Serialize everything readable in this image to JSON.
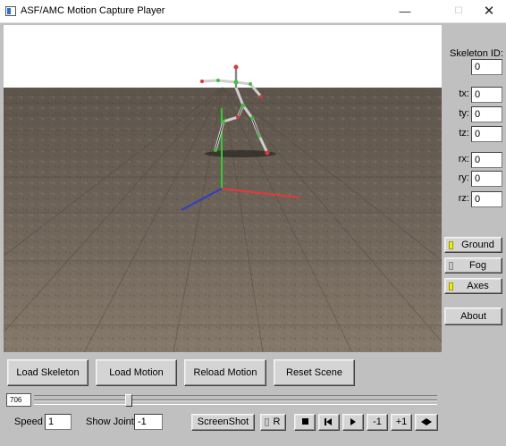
{
  "window": {
    "title": "ASF/AMC Motion Capture Player",
    "min_glyph": "—",
    "max_glyph": "☐",
    "close_glyph": "✕"
  },
  "colors": {
    "sky": "#ffffff",
    "ground": "#6e6256",
    "x_axis": "#e23a3a",
    "y_axis": "#2ecf2e",
    "z_axis": "#2c3ec9",
    "bone": "#c8c8c8",
    "joint_green": "#3fbf3f",
    "joint_red": "#d63a3a",
    "led_on": "#f2f200",
    "panel": "#c0c0c0"
  },
  "right_panel": {
    "skeleton_id_label": "Skeleton ID:",
    "skeleton_id_value": "0",
    "tx_label": "tx:",
    "tx_value": "0",
    "ty_label": "ty:",
    "ty_value": "0",
    "tz_label": "tz:",
    "tz_value": "0",
    "rx_label": "rx:",
    "rx_value": "0",
    "ry_label": "ry:",
    "ry_value": "0",
    "rz_label": "rz:",
    "rz_value": "0",
    "ground_label": "Ground",
    "ground_on": true,
    "fog_label": "Fog",
    "fog_on": false,
    "axes_label": "Axes",
    "axes_on": true,
    "about_label": "About"
  },
  "buttons": {
    "load_skeleton": "Load Skeleton",
    "load_motion": "Load Motion",
    "reload_motion": "Reload Motion",
    "reset_scene": "Reset Scene"
  },
  "timeline": {
    "frame_value": "706",
    "position_fraction": 0.23
  },
  "controls": {
    "speed_label": "Speed",
    "speed_value": "1",
    "show_joint_label": "Show Joint",
    "show_joint_value": "-1",
    "screenshot_label": "ScreenShot",
    "record_label": "R",
    "record_on": false,
    "minus_one_label": "-1",
    "plus_one_label": "+1"
  },
  "icons": {
    "stop": "stop-icon",
    "rewind": "rewind-icon",
    "play": "play-icon",
    "repeat": "repeat-icon"
  }
}
